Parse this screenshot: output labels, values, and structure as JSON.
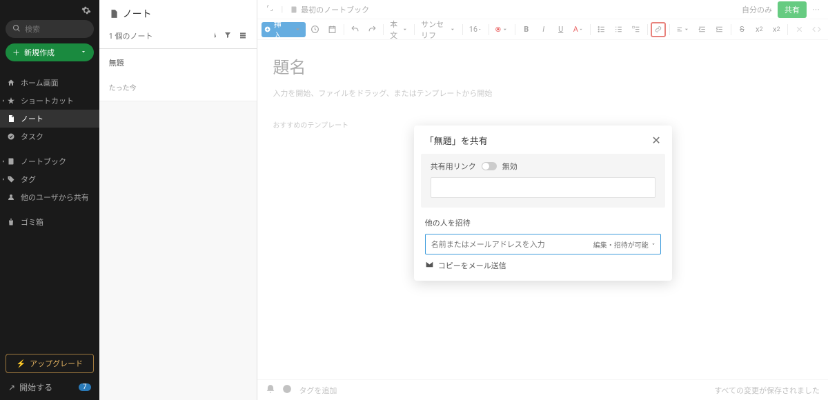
{
  "sidebar": {
    "search_placeholder": "検索",
    "new_label": "新規作成",
    "items": [
      {
        "label": "ホーム画面"
      },
      {
        "label": "ショートカット"
      },
      {
        "label": "ノート"
      },
      {
        "label": "タスク"
      },
      {
        "label": "ノートブック"
      },
      {
        "label": "タグ"
      },
      {
        "label": "他のユーザから共有"
      },
      {
        "label": "ゴミ箱"
      }
    ],
    "upgrade_label": "アップグレード",
    "start_label": "開始する",
    "start_badge": "7"
  },
  "notelist": {
    "title": "ノート",
    "count": "1 個のノート",
    "card_title": "無題",
    "card_date": "たった今"
  },
  "editor": {
    "notebook": "最初のノートブック",
    "only_you": "自分のみ",
    "share_btn": "共有",
    "insert_label": "挿入",
    "body_style": "本文",
    "font_family": "サンセリフ",
    "font_size": "16",
    "title_placeholder": "題名",
    "body_placeholder": "入力を開始、ファイルをドラッグ、またはテンプレートから開始",
    "templates_label": "おすすめのテンプレート",
    "tag_add": "タグを追加",
    "saved_label": "すべての変更が保存されました"
  },
  "dialog": {
    "title": "「無題」を共有",
    "share_link_label": "共有用リンク",
    "share_link_status": "無効",
    "invite_label": "他の人を招待",
    "invite_placeholder": "名前またはメールアドレスを入力",
    "permission": "編集・招待が可能",
    "email_copy": "コピーをメール送信"
  }
}
